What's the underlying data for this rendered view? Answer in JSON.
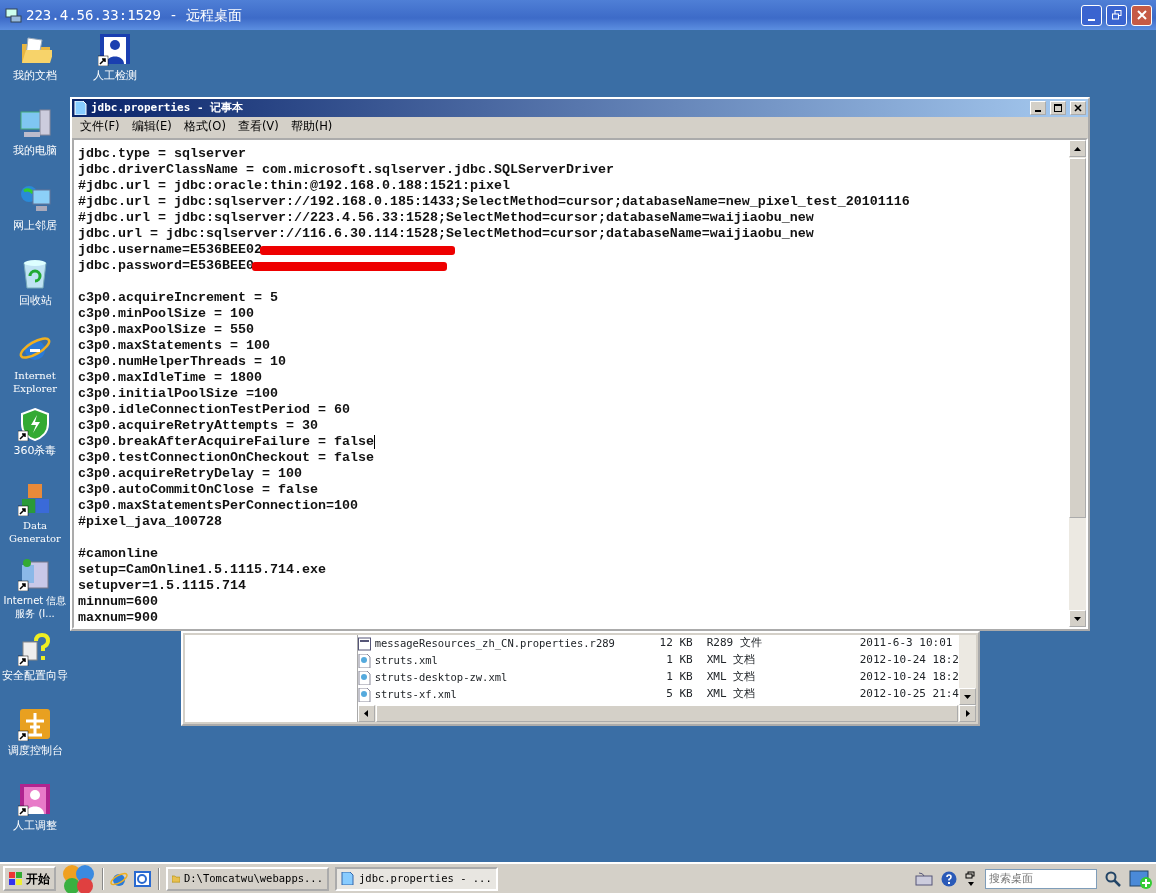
{
  "remote_window": {
    "title": "223.4.56.33:1529 - 远程桌面"
  },
  "desktop_icon_rows": [
    [
      {
        "label": "我的文档",
        "kind": "folder"
      },
      {
        "label": "人工检测",
        "kind": "person",
        "shortcut": true
      }
    ],
    [
      {
        "label": "我的电脑",
        "kind": "computer"
      }
    ],
    [
      {
        "label": "网上邻居",
        "kind": "network"
      }
    ],
    [
      {
        "label": "回收站",
        "kind": "recycle"
      }
    ],
    [
      {
        "label": "Internet Explorer",
        "kind": "browser"
      }
    ],
    [
      {
        "label": "360杀毒",
        "kind": "shield",
        "shortcut": true
      }
    ],
    [
      {
        "label": "Data Generator",
        "kind": "blocks",
        "shortcut": true
      }
    ],
    [
      {
        "label": "Internet 信息服务 (I...",
        "kind": "server",
        "shortcut": true
      }
    ],
    [
      {
        "label": "安全配置向导",
        "kind": "wizard",
        "shortcut": true
      }
    ],
    [
      {
        "label": "调度控制台",
        "kind": "console",
        "shortcut": true
      }
    ],
    [
      {
        "label": "人工调整",
        "kind": "person_pink",
        "shortcut": true
      }
    ]
  ],
  "explorer_window": {
    "rows": [
      {
        "name": "messageResources_zh_CN.properties.r289",
        "size": "12 KB",
        "type": "R289 文件",
        "date": "2011-6-3 10:01",
        "kind": "file"
      },
      {
        "name": "struts.xml",
        "size": "1 KB",
        "type": "XML 文档",
        "date": "2012-10-24 18:2",
        "kind": "xml"
      },
      {
        "name": "struts-desktop-zw.xml",
        "size": "1 KB",
        "type": "XML 文档",
        "date": "2012-10-24 18:2",
        "kind": "xml"
      },
      {
        "name": "struts-xf.xml",
        "size": "5 KB",
        "type": "XML 文档",
        "date": "2012-10-25 21:4",
        "kind": "xml"
      }
    ]
  },
  "notepad": {
    "title": "jdbc.properties - 记事本",
    "menu": [
      "文件(F)",
      "编辑(E)",
      "格式(O)",
      "查看(V)",
      "帮助(H)"
    ],
    "paragraphs": [
      [
        {
          "text": "jdbc.type = sqlserver"
        },
        {
          "text": "jdbc.driverClassName = com.microsoft.sqlserver.jdbc.SQLServerDriver"
        },
        {
          "text": "#jdbc.url = jdbc:oracle:thin:@192.168.0.188:1521:pixel"
        },
        {
          "text": "#jdbc.url = jdbc:sqlserver://192.168.0.185:1433;SelectMethod=cursor;databaseName=new_pixel_test_20101116"
        },
        {
          "text": "#jdbc.url = jdbc:sqlserver://223.4.56.33:1528;SelectMethod=cursor;databaseName=waijiaobu_new"
        },
        {
          "text": "jdbc.url = jdbc:sqlserver://116.6.30.114:1528;SelectMethod=cursor;databaseName=waijiaobu_new"
        },
        {
          "text": "jdbc.username=E536BEE02",
          "redacted": true
        },
        {
          "text": "jdbc.password=E536BEE0",
          "redacted": true
        }
      ],
      [
        {
          "text": "c3p0.acquireIncrement = 5"
        },
        {
          "text": "c3p0.minPoolSize = 100"
        },
        {
          "text": "c3p0.maxPoolSize = 550"
        },
        {
          "text": "c3p0.maxStatements = 100"
        },
        {
          "text": "c3p0.numHelperThreads = 10"
        },
        {
          "text": "c3p0.maxIdleTime = 1800"
        },
        {
          "text": "c3p0.initialPoolSize =100"
        },
        {
          "text": "c3p0.idleConnectionTestPeriod = 60"
        },
        {
          "text": "c3p0.acquireRetryAttempts = 30"
        },
        {
          "text": "c3p0.breakAfterAcquireFailure = false",
          "caret": true
        },
        {
          "text": "c3p0.testConnectionOnCheckout = false"
        },
        {
          "text": "c3p0.acquireRetryDelay = 100"
        },
        {
          "text": "c3p0.autoCommitOnClose = false"
        },
        {
          "text": "c3p0.maxStatementsPerConnection=100"
        },
        {
          "text": "#pixel_java_100728"
        }
      ],
      [
        {
          "text": "#camonline"
        },
        {
          "text": "setup=CamOnline1.5.1115.714.exe"
        },
        {
          "text": "setupver=1.5.1115.714"
        },
        {
          "text": "minnum=600"
        },
        {
          "text": "maxnum=900"
        }
      ]
    ]
  },
  "taskbar": {
    "start": "开始",
    "tasks": [
      {
        "label": "D:\\Tomcatwu\\webapps...",
        "kind": "folder",
        "selected": false
      },
      {
        "label": "jdbc.properties - ...",
        "kind": "notepad",
        "selected": true
      }
    ],
    "search": {
      "placeholder": "搜索桌面"
    }
  }
}
